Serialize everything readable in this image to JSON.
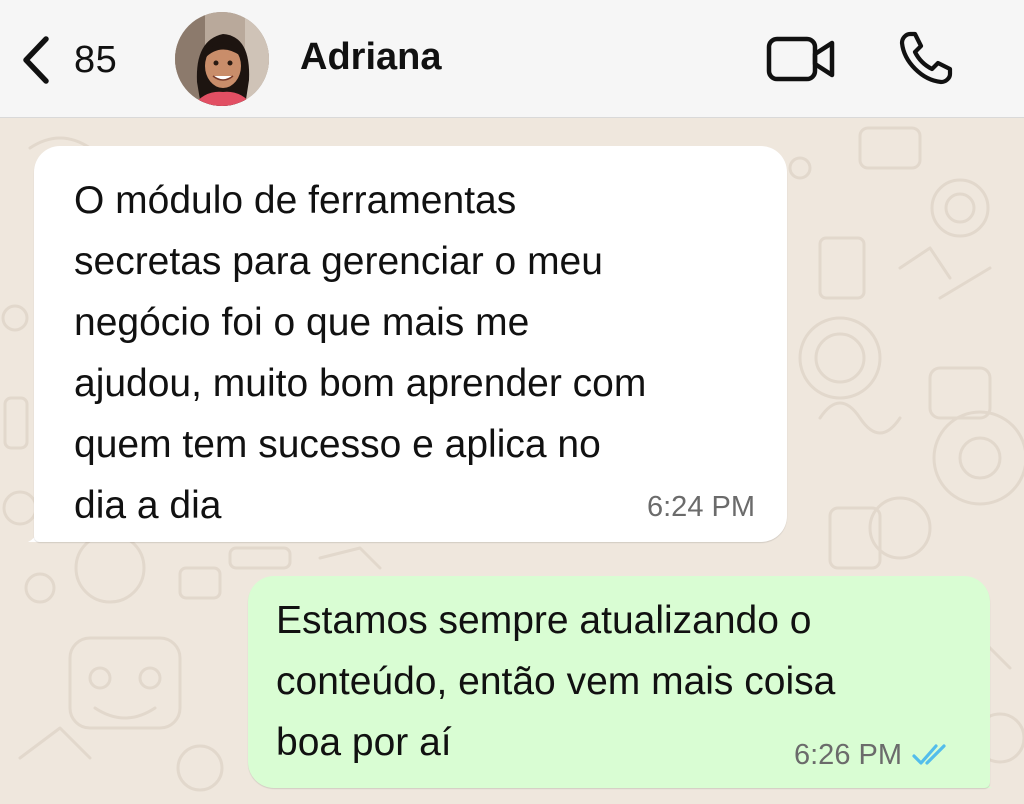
{
  "header": {
    "unread_count": "85",
    "contact_name": "Adriana",
    "avatar_icon": "person-photo-icon",
    "back_icon": "chevron-left-icon",
    "video_icon": "video-camera-icon",
    "call_icon": "phone-icon"
  },
  "messages": [
    {
      "direction": "incoming",
      "text": "O módulo de ferramentas\nsecretas para gerenciar o meu\nnegócio foi o que mais me\najudou, muito bom aprender com\nquem tem sucesso e aplica no\ndia a dia",
      "time": "6:24 PM"
    },
    {
      "direction": "outgoing",
      "text": "Estamos sempre atualizando o\nconteúdo, então vem mais coisa\nboa por aí",
      "time": "6:26 PM",
      "status_icon": "double-check-read-icon",
      "status_color": "#53bdeb"
    }
  ],
  "colors": {
    "header_bg": "#f6f6f6",
    "chat_bg": "#efe7dd",
    "incoming_bubble": "#ffffff",
    "outgoing_bubble": "#d9fdd3"
  }
}
